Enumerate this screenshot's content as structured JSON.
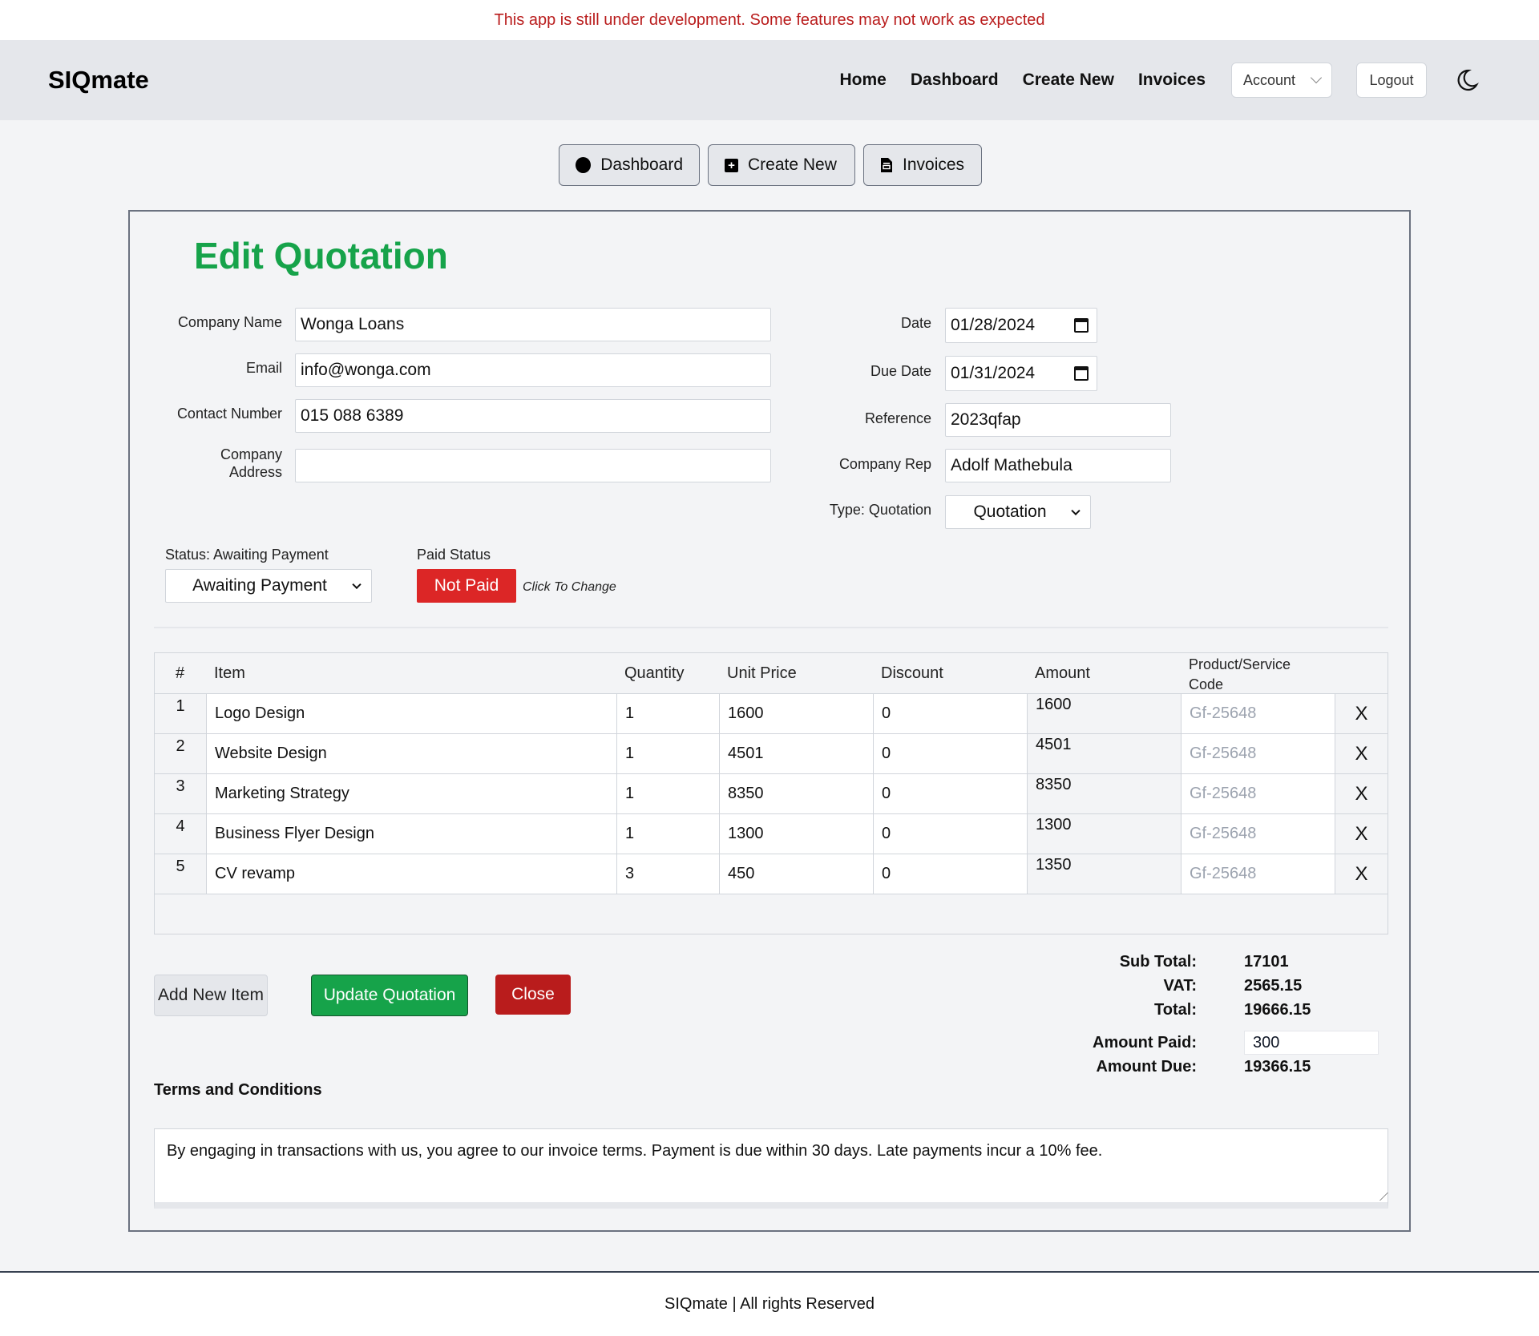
{
  "banner": {
    "text": "This app is still under development. Some features may not work as expected"
  },
  "navbar": {
    "brand": "SIQmate",
    "links": [
      "Home",
      "Dashboard",
      "Create New",
      "Invoices"
    ],
    "account_label": "Account",
    "logout_label": "Logout",
    "theme_icon": "moon-icon"
  },
  "quick_actions": [
    {
      "label": "Dashboard",
      "icon": "circle-icon"
    },
    {
      "label": "Create New",
      "icon": "plus-square-icon"
    },
    {
      "label": "Invoices",
      "icon": "document-icon"
    }
  ],
  "form": {
    "title": "Edit Quotation",
    "company_name": {
      "label": "Company Name",
      "value": "Wonga Loans"
    },
    "email": {
      "label": "Email",
      "value": "info@wonga.com"
    },
    "contact_number": {
      "label": "Contact Number",
      "value": "015 088 6389"
    },
    "company_address": {
      "label_line1": "Company",
      "label_line2": "Address",
      "value": ""
    },
    "date": {
      "label": "Date",
      "value": "01/28/2024"
    },
    "due_date": {
      "label": "Due Date",
      "value": "01/31/2024"
    },
    "reference": {
      "label": "Reference",
      "value": "2023qfap"
    },
    "company_rep": {
      "label": "Company Rep",
      "value": "Adolf Mathebula"
    },
    "type": {
      "label": "Type: Quotation",
      "selected": "Quotation"
    },
    "status": {
      "label": "Status: Awaiting Payment",
      "selected": "Awaiting Payment"
    },
    "paid_status": {
      "label": "Paid Status",
      "button": "Not Paid",
      "hint": "Click To Change"
    }
  },
  "items_table": {
    "headers": [
      "#",
      "Item",
      "Quantity",
      "Unit Price",
      "Discount",
      "Amount",
      "Product/Service Code"
    ],
    "rows": [
      {
        "num": "1",
        "item": "Logo Design",
        "quantity": "1",
        "unit_price": "1600",
        "discount": "0",
        "amount": "1600",
        "code": "Gf-25648"
      },
      {
        "num": "2",
        "item": "Website Design",
        "quantity": "1",
        "unit_price": "4501",
        "discount": "0",
        "amount": "4501",
        "code": "Gf-25648"
      },
      {
        "num": "3",
        "item": "Marketing Strategy",
        "quantity": "1",
        "unit_price": "8350",
        "discount": "0",
        "amount": "8350",
        "code": "Gf-25648"
      },
      {
        "num": "4",
        "item": "Business Flyer Design",
        "quantity": "1",
        "unit_price": "1300",
        "discount": "0",
        "amount": "1300",
        "code": "Gf-25648"
      },
      {
        "num": "5",
        "item": "CV revamp",
        "quantity": "3",
        "unit_price": "450",
        "discount": "0",
        "amount": "1350",
        "code": "Gf-25648"
      }
    ],
    "remove_label": "X"
  },
  "actions": {
    "add_item": "Add New Item",
    "update": "Update Quotation",
    "close": "Close"
  },
  "totals": {
    "sub_total_label": "Sub Total:",
    "sub_total": "17101",
    "vat_label": "VAT:",
    "vat": "2565.15",
    "total_label": "Total:",
    "total": "19666.15",
    "amount_paid_label": "Amount Paid:",
    "amount_paid": "300",
    "amount_due_label": "Amount Due:",
    "amount_due": "19366.15"
  },
  "terms": {
    "heading": "Terms and Conditions",
    "text": "By engaging in transactions with us, you agree to our invoice terms. Payment is due within 30 days. Late payments incur a 10% fee."
  },
  "footer": {
    "text": "SIQmate | All rights Reserved"
  },
  "colors": {
    "accent_green": "#16a34a",
    "danger_red": "#dc2626",
    "close_red": "#b91c1c",
    "banner_red": "#b91c1c"
  }
}
